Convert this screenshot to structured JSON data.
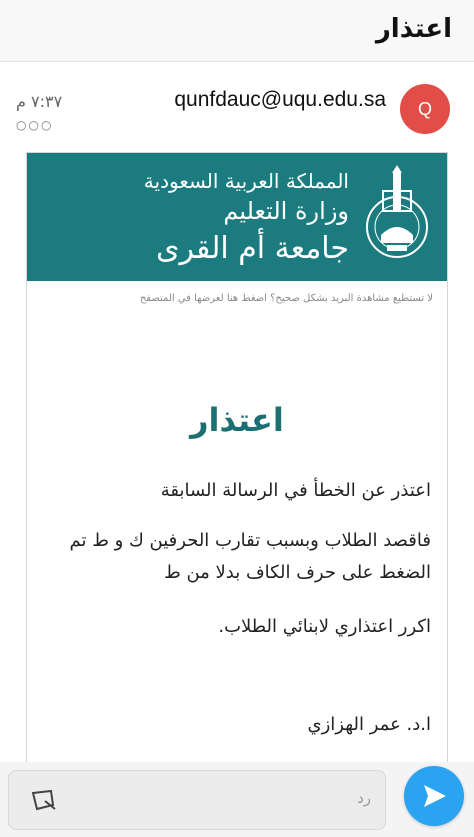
{
  "header": {
    "title": "اعتذار"
  },
  "sender": {
    "avatar_letter": "Q",
    "email": "qunfdauc@uqu.edu.sa",
    "time": "٧:٣٧ م",
    "more_dots": "○○○"
  },
  "banner": {
    "line1": "المملكة العربية السعودية",
    "line2": "وزارة التعليم",
    "line3": "جامعة أم القرى",
    "logo_icon": "university-seal-icon"
  },
  "view_in_browser_note": "لا تستطيع مشاهدة البريد بشكل صحيح؟ اضغط هنا لعرضها في المتصفح",
  "message": {
    "title": "اعتذار",
    "paragraph1": "اعتذر عن الخطأ في الرسالة السابقة",
    "paragraph2": "فاقصد الطلاب وبسبب تقارب الحرفين ك و ط تم الضغط على حرف الكاف بدلا من ط",
    "paragraph3": "اكرر اعتذاري لابنائي الطلاب.",
    "signature": "ا.د. عمر الهزازي"
  },
  "reply": {
    "placeholder": "رد"
  },
  "colors": {
    "banner": "#1c7b7e",
    "title": "#1c6f73",
    "avatar": "#e34d47",
    "send": "#2aa3f0"
  }
}
